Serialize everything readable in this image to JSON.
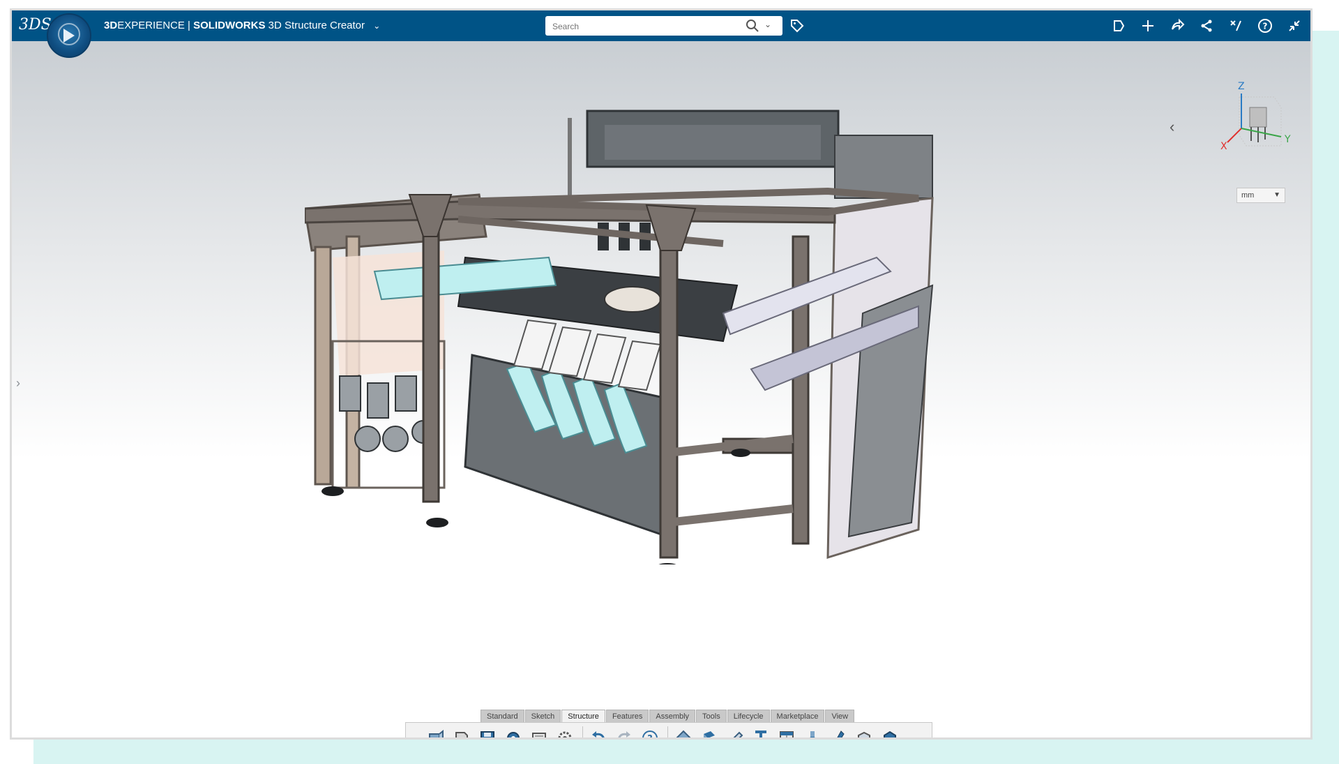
{
  "header": {
    "brand_logo": "3DS",
    "brand_bold": "3D",
    "brand_rest": "EXPERIENCE | ",
    "brand_product": "SOLIDWORKS",
    "app_name": "3D Structure Creator"
  },
  "search": {
    "placeholder": "Search"
  },
  "top_actions": [
    "share-icon",
    "add-icon",
    "collaborate-icon",
    "send-icon",
    "tools-icon",
    "help-icon",
    "collapse-icon"
  ],
  "view": {
    "units": "mm",
    "axes": {
      "x": "X",
      "y": "Y",
      "z": "Z"
    }
  },
  "toolbar": {
    "tabs": [
      {
        "label": "Standard",
        "active": false
      },
      {
        "label": "Sketch",
        "active": false
      },
      {
        "label": "Structure",
        "active": true
      },
      {
        "label": "Features",
        "active": false
      },
      {
        "label": "Assembly",
        "active": false
      },
      {
        "label": "Tools",
        "active": false
      },
      {
        "label": "Lifecycle",
        "active": false
      },
      {
        "label": "Marketplace",
        "active": false
      },
      {
        "label": "View",
        "active": false
      }
    ],
    "buttons": [
      "new-part-icon",
      "open-icon",
      "save-icon",
      "rebuild-icon",
      "options-icon",
      "settings-icon",
      "undo-icon",
      "redo-icon",
      "help-icon",
      "structure-system-icon",
      "corner-management-icon",
      "cut-list-icon",
      "member-icon",
      "weldment-icon",
      "gusset-icon",
      "end-cap-icon",
      "trim-extend-icon",
      "solid-body-icon"
    ]
  },
  "colors": {
    "topbar": "#005386",
    "frame": "#7a726d",
    "panel": "#6f7479",
    "accent_cyan": "#8fd8d8"
  }
}
